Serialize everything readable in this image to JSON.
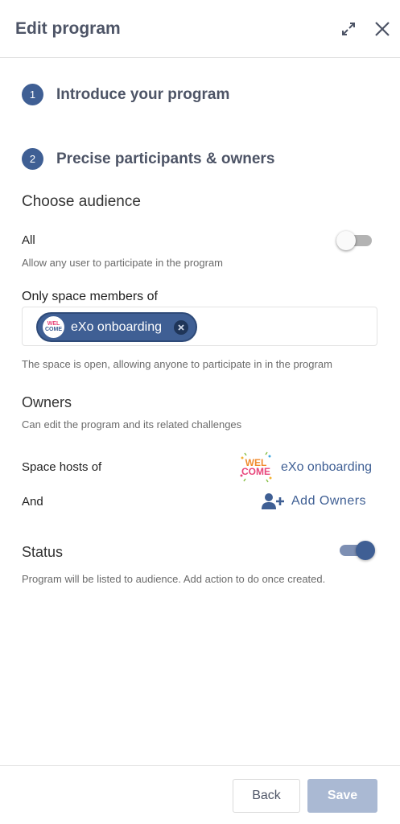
{
  "header": {
    "title": "Edit program"
  },
  "steps": [
    {
      "number": "1",
      "label": "Introduce your program"
    },
    {
      "number": "2",
      "label": "Precise participants & owners"
    }
  ],
  "audience": {
    "heading": "Choose audience",
    "all_label": "All",
    "all_description": "Allow any user to participate in the program",
    "all_enabled": false,
    "space_members_label": "Only space members of",
    "selected_space": "eXo onboarding",
    "space_note": "The space is open, allowing anyone to participate in in the program"
  },
  "owners": {
    "heading": "Owners",
    "description": "Can edit the program and its related challenges",
    "space_hosts_label": "Space hosts of",
    "space_hosts_value": "eXo onboarding",
    "and_label": "And",
    "add_owners_label": "Add Owners"
  },
  "logo": {
    "line1": "WEL",
    "line2": "COME"
  },
  "status": {
    "heading": "Status",
    "description": "Program will be listed to audience. Add action to do once created.",
    "enabled": true
  },
  "footer": {
    "back_label": "Back",
    "save_label": "Save"
  },
  "colors": {
    "primary": "#3f5f94",
    "save_disabled": "#aab9d3",
    "title": "#4d5466"
  }
}
